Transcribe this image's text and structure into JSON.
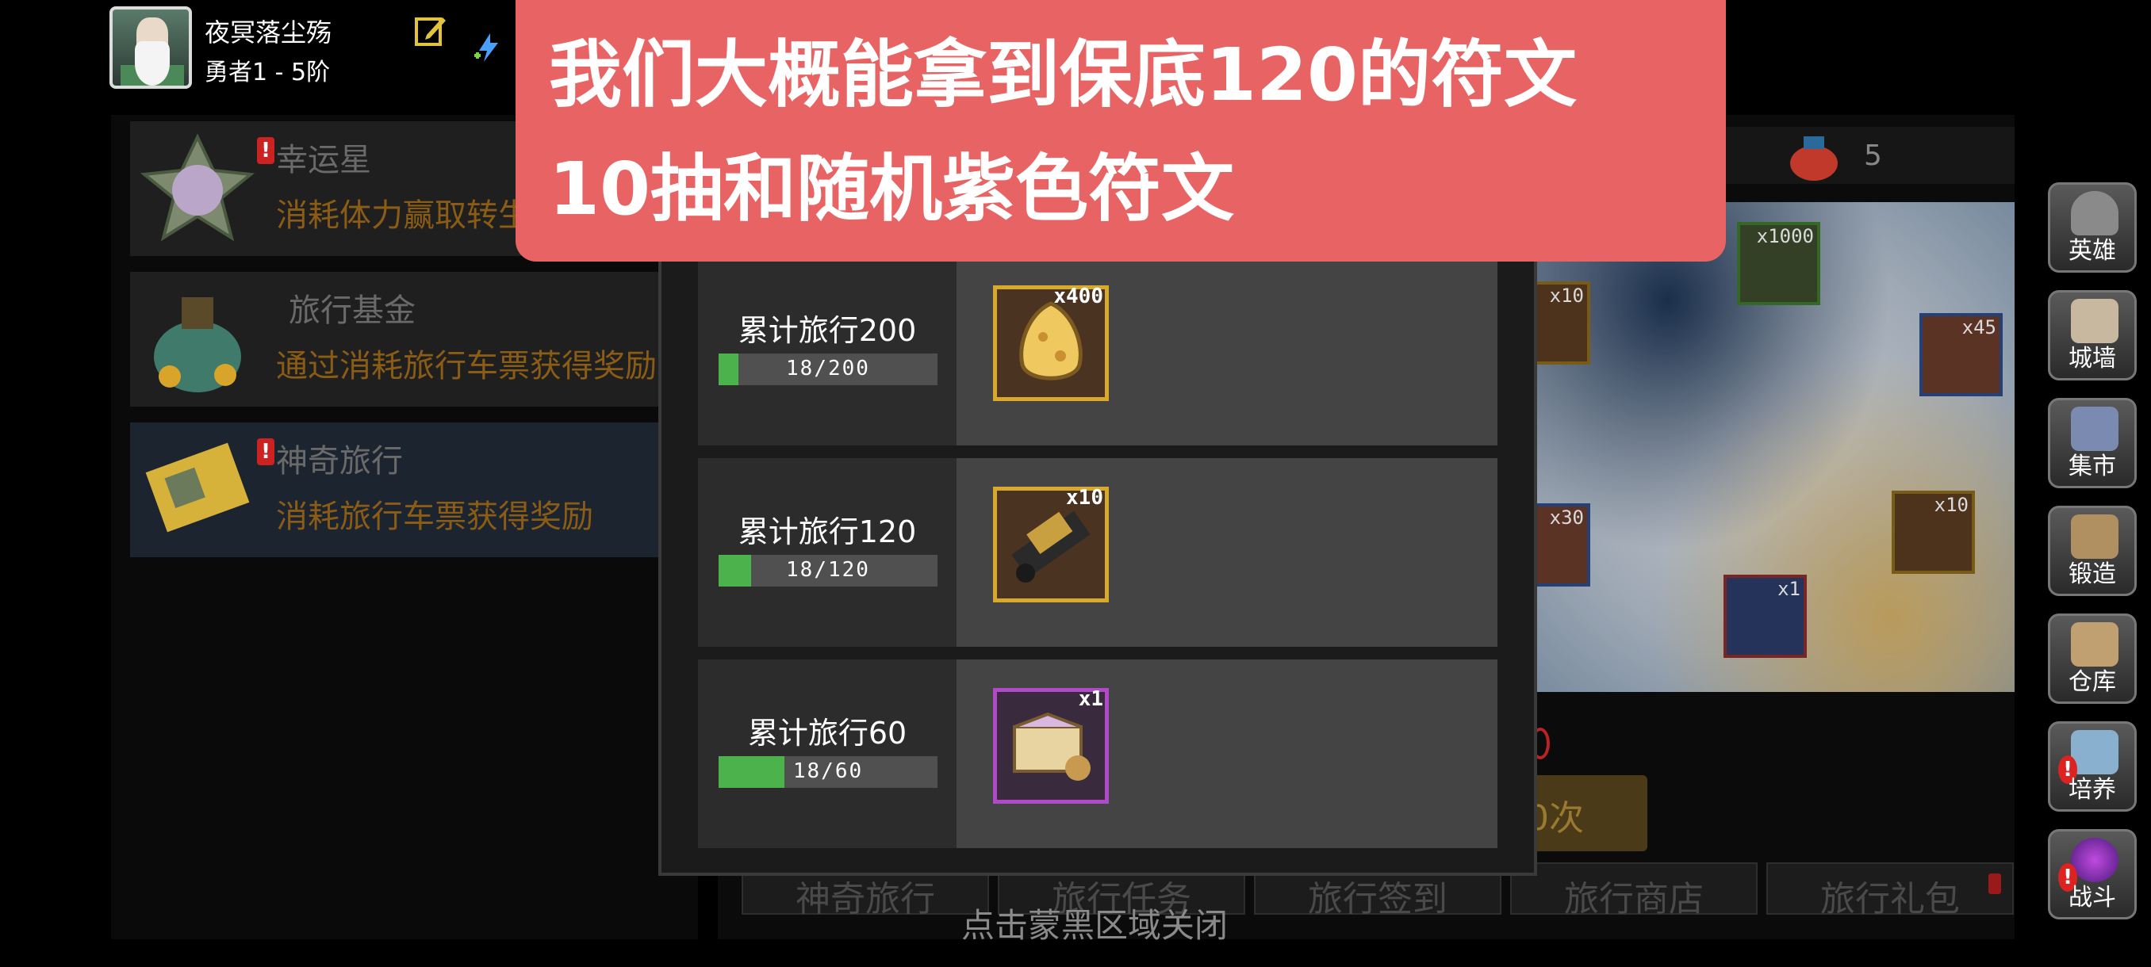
{
  "player": {
    "name": "夜冥落尘殇",
    "rank": "勇者1 - 5阶"
  },
  "activities": [
    {
      "title": "幸运星",
      "desc": "消耗体力赢取转生",
      "badge": "!"
    },
    {
      "title": "旅行基金",
      "desc": "通过消耗旅行车票获得奖励"
    },
    {
      "title": "神奇旅行",
      "desc": "消耗旅行车票获得奖励",
      "badge": "!"
    }
  ],
  "map": {
    "count": "5",
    "items": [
      "x1000",
      "x10",
      "x45",
      "x30",
      "x10",
      "x1"
    ]
  },
  "ten_draw_partial": "0次",
  "tabs": [
    "神奇旅行",
    "旅行任务",
    "旅行签到",
    "旅行商店",
    "旅行礼包"
  ],
  "sidebar": [
    {
      "label": "英雄"
    },
    {
      "label": "城墙"
    },
    {
      "label": "集市"
    },
    {
      "label": "锻造"
    },
    {
      "label": "仓库"
    },
    {
      "label": "培养",
      "alert": "!"
    },
    {
      "label": "战斗",
      "alert": "!"
    }
  ],
  "modal": {
    "rows": [
      {
        "label": "累计旅行200",
        "progress_text": "18/200",
        "progress": 0.09,
        "reward_qty": "x400",
        "reward_icon": "golden-egg-icon"
      },
      {
        "label": "累计旅行120",
        "progress_text": "18/120",
        "progress": 0.15,
        "reward_qty": "x10",
        "reward_icon": "scroll-icon"
      },
      {
        "label": "累计旅行60",
        "progress_text": "18/60",
        "progress": 0.3,
        "reward_qty": "x1",
        "reward_icon": "purple-rune-chest-icon"
      }
    ],
    "close_hint": "点击蒙黑区域关闭"
  },
  "caption": {
    "line1": "我们大概能拿到保底120的符文",
    "line2": "10抽和随机紫色符文"
  },
  "colors": {
    "caption_bg": "#e86464",
    "progress_fill": "#4cb24c",
    "gold_frame": "#d8a92a",
    "purple_frame": "#b04ac8"
  }
}
